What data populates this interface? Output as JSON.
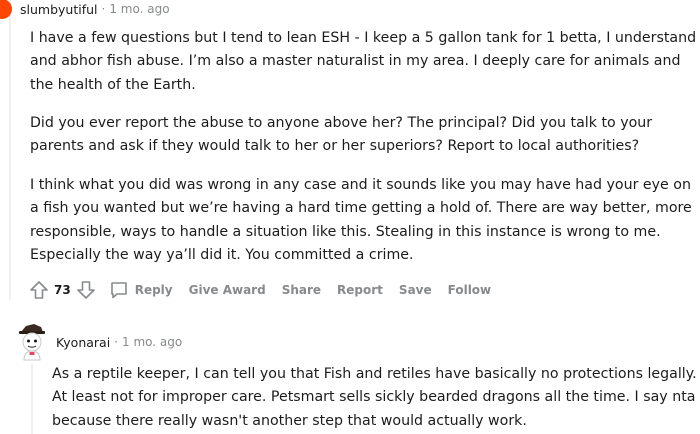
{
  "comment1": {
    "username": "slumbyutiful",
    "separator": "·",
    "time": "1 mo. ago",
    "paragraphs": [
      "I have a few questions but I tend to lean ESH - I keep a 5 gallon tank for 1 betta, I understand and abhor fish abuse. I’m also a master naturalist in my area. I deeply care for animals and the health of the Earth.",
      "Did you ever report the abuse to anyone above her? The principal? Did you talk to your parents and ask if they would talk to her or her superiors? Report to local authorities?",
      "I think what you did was wrong in any case and it sounds like you may have had your eye on a fish you wanted but we’re having a hard time getting a hold of. There are way better, more responsible, ways to handle a situation like this. Stealing in this instance is wrong to me. Especially the way ya’ll did it. You committed a crime."
    ],
    "actions": {
      "upvote_icon": "arrow-up-icon",
      "score": "73",
      "downvote_icon": "arrow-down-icon",
      "reply_icon": "speech-bubble-icon",
      "reply": "Reply",
      "give_award": "Give Award",
      "share": "Share",
      "report": "Report",
      "save": "Save",
      "follow": "Follow"
    }
  },
  "comment2": {
    "username": "Kyonarai",
    "separator": "·",
    "time": "1 mo. ago",
    "paragraphs": [
      "As a reptile keeper, I can tell you that Fish and retiles have basically no protections legally. At least not for improper care. Petsmart sells sickly bearded dragons all the time. I say nta because there really wasn't another step that would actually work."
    ]
  },
  "colors": {
    "text": "#1c1c1c",
    "meta": "#878a8c",
    "thread_line": "#edeff1",
    "avatar_orange": "#ff4500"
  }
}
